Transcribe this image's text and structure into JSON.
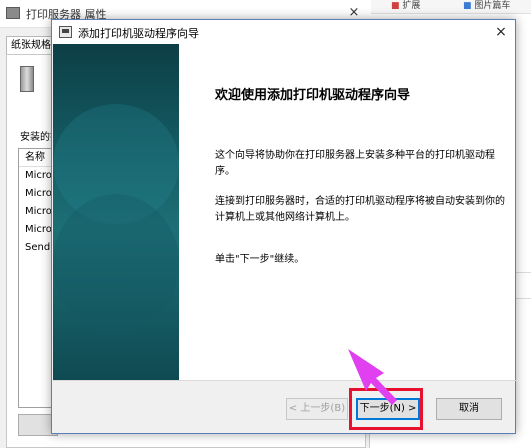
{
  "background_window": {
    "title": "打印服务器 属性",
    "close_glyph": "×",
    "tab_label": "纸张规格",
    "list_label": "安装的打",
    "list_header": "名称",
    "list_rows": [
      "Micro",
      "Micro",
      "Micro",
      "Micro",
      "Send"
    ]
  },
  "browser": {
    "toolbar_items": [
      "扩展",
      "图片篇车"
    ]
  },
  "wizard": {
    "title": "添加打印机驱动程序向导",
    "close_glyph": "×",
    "heading": "欢迎使用添加打印机驱动程序向导",
    "para1": "这个向导将协助你在打印服务器上安装多种平台的打印机驱动程序。",
    "para2": "连接到打印服务器时，合适的打印机驱动程序将被自动安装到你的计算机上或其他网络计算机上。",
    "para3": "单击\"下一步\"继续。",
    "back_button": "< 上一步(B)",
    "next_button": "下一步(N) >",
    "cancel_button": "取消"
  },
  "colors": {
    "highlight": "#e8102f",
    "arrow": "#e040f0",
    "banner": "#145a62"
  }
}
